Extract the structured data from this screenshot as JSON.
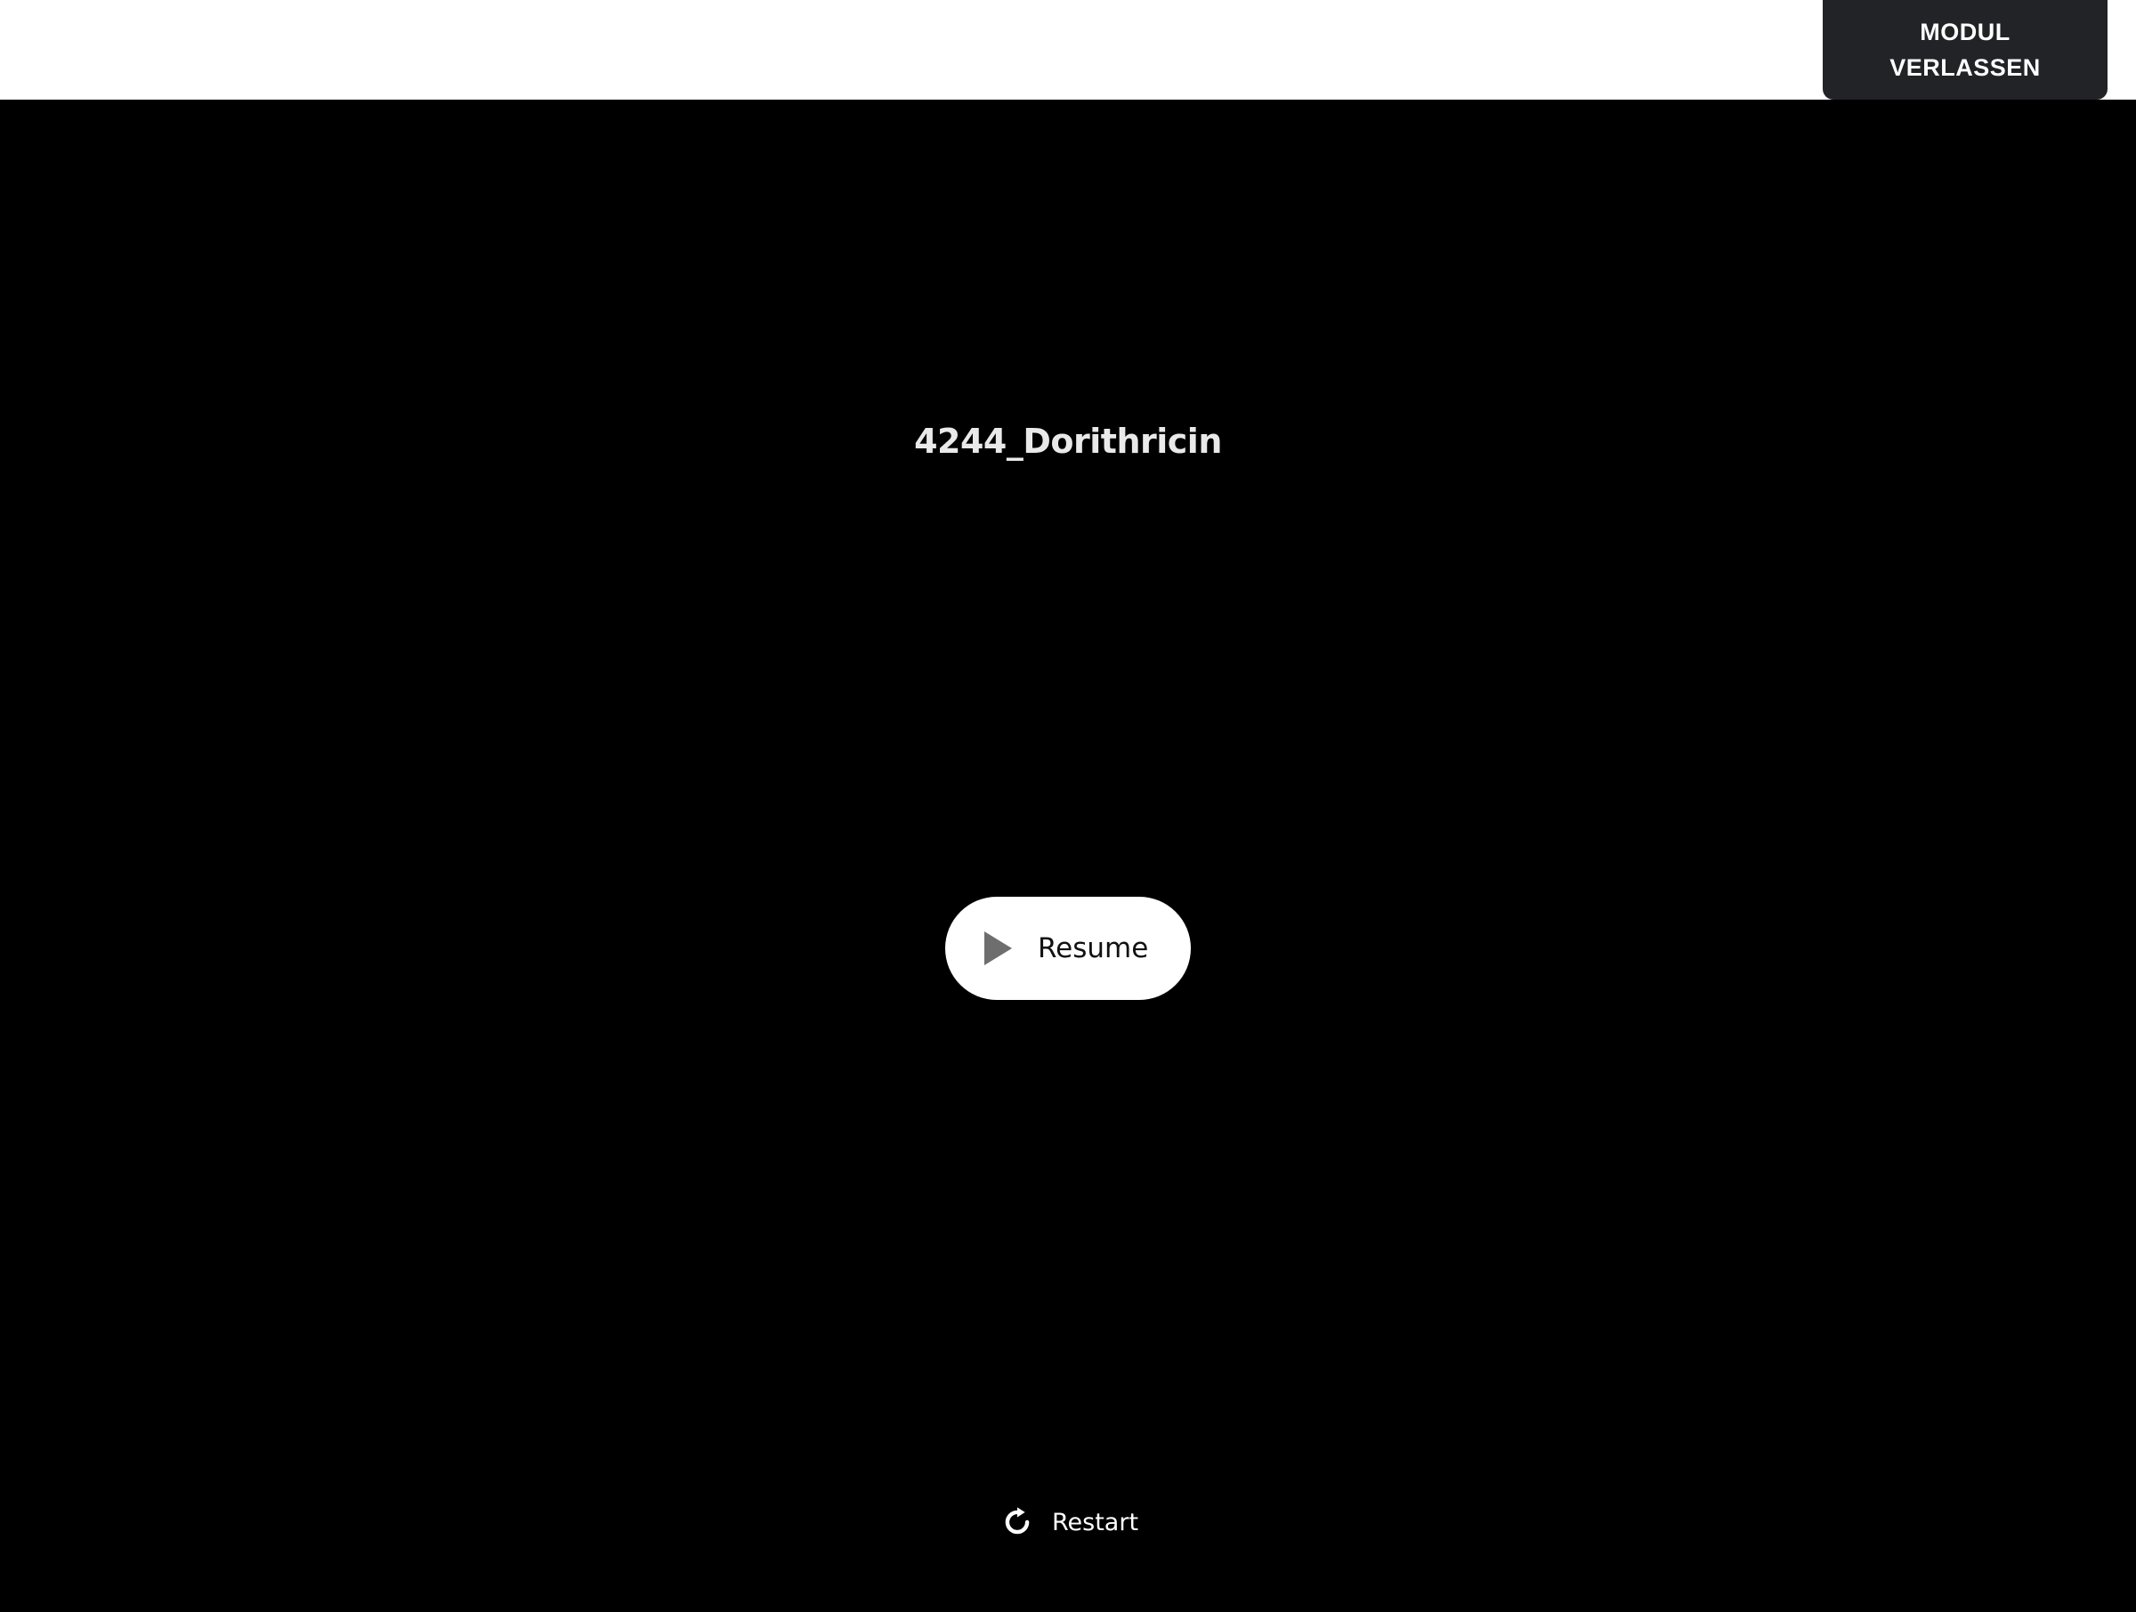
{
  "header": {
    "exit_button_label": "MODUL\nVERLASSEN"
  },
  "player": {
    "module_title": "4244_Dorithricin",
    "resume_label": "Resume",
    "restart_label": "Restart",
    "icons": {
      "play": "play-icon",
      "restart": "restart-icon"
    },
    "colors": {
      "background": "#000000",
      "exit_button_bg": "#222327",
      "resume_button_bg": "#ffffff"
    }
  }
}
